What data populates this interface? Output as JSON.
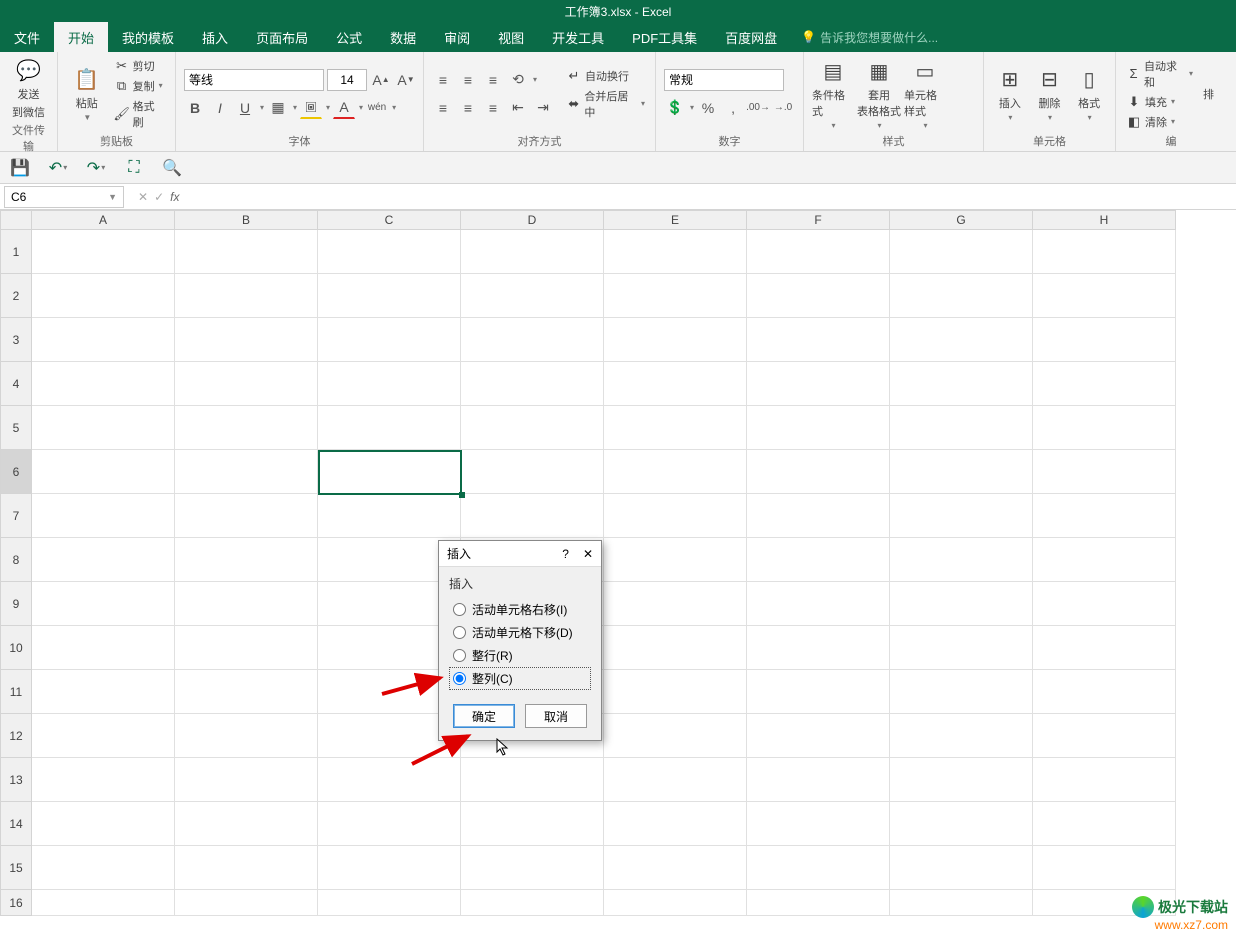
{
  "title": "工作簿3.xlsx - Excel",
  "tabs": [
    "文件",
    "开始",
    "我的模板",
    "插入",
    "页面布局",
    "公式",
    "数据",
    "审阅",
    "视图",
    "开发工具",
    "PDF工具集",
    "百度网盘"
  ],
  "active_tab_index": 1,
  "tellme": "告诉我您想要做什么...",
  "groups": {
    "clipboard": {
      "label": "剪贴板",
      "cut": "剪切",
      "copy": "复制",
      "fmtpainter": "格式刷",
      "paste": "粘贴"
    },
    "wechat": {
      "send": "发送",
      "to": "到微信",
      "section": "文件传输"
    },
    "font": {
      "label": "字体",
      "name": "等线",
      "size": "14",
      "bold": "B",
      "italic": "I",
      "underline": "U",
      "pinyin": "wén"
    },
    "align": {
      "label": "对齐方式",
      "wrap": "自动换行",
      "merge": "合并后居中"
    },
    "number": {
      "label": "数字",
      "format": "常规"
    },
    "styles": {
      "label": "样式",
      "cond": "条件格式",
      "table": "套用\n表格格式",
      "cell": "单元格样式"
    },
    "cells": {
      "label": "单元格",
      "insert": "插入",
      "delete": "删除",
      "format": "格式"
    },
    "editing": {
      "sum": "自动求和",
      "fill": "填充",
      "clear": "清除",
      "sort": "排"
    }
  },
  "namebox": "C6",
  "columns": [
    "A",
    "B",
    "C",
    "D",
    "E",
    "F",
    "G",
    "H"
  ],
  "rows": [
    "1",
    "2",
    "3",
    "4",
    "5",
    "6",
    "7",
    "8",
    "9",
    "10",
    "11",
    "12",
    "13",
    "14",
    "15",
    "16"
  ],
  "selected_row_index": 5,
  "dialog": {
    "title": "插入",
    "group": "插入",
    "options": [
      "活动单元格右移(I)",
      "活动单元格下移(D)",
      "整行(R)",
      "整列(C)"
    ],
    "selected": 3,
    "ok": "确定",
    "cancel": "取消"
  },
  "watermark": {
    "t1": "极光下载站",
    "t2": "www.xz7.com"
  }
}
